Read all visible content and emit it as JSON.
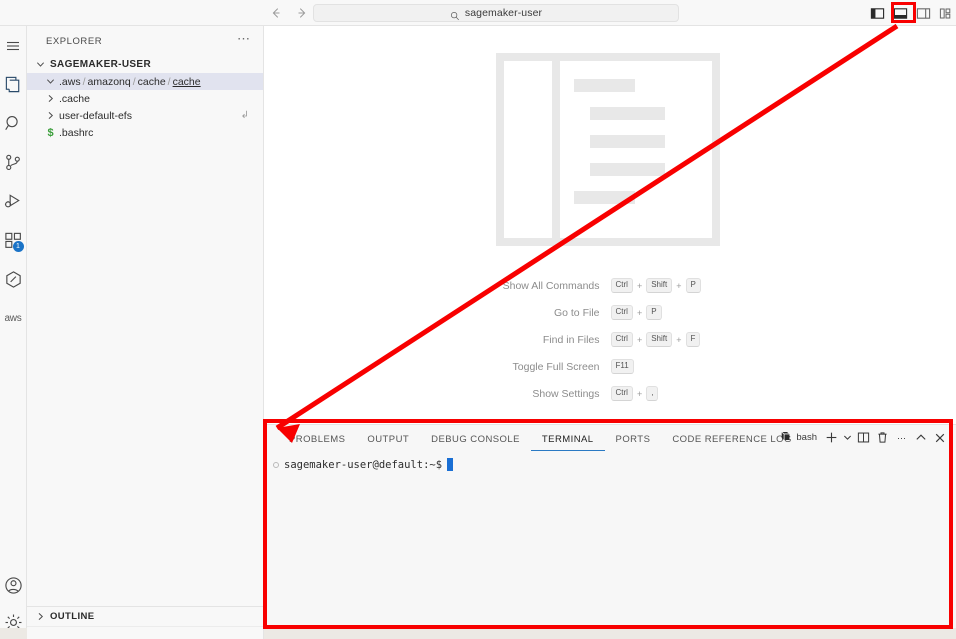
{
  "titlebar": {
    "back_icon": "arrow-left-icon",
    "forward_icon": "arrow-right-icon",
    "command_center": {
      "search_icon": "search-icon",
      "value": "sagemaker-user"
    },
    "layout_buttons": [
      {
        "name": "toggle-primary-sidebar",
        "icon": "panel-left-icon"
      },
      {
        "name": "toggle-panel",
        "icon": "panel-bottom-icon"
      },
      {
        "name": "toggle-secondary-sidebar",
        "icon": "panel-right-icon"
      },
      {
        "name": "customize-layout",
        "icon": "layout-grid-icon"
      }
    ]
  },
  "activitybar": {
    "items": [
      {
        "name": "menu",
        "icon": "hamburger-menu-icon",
        "badge": ""
      },
      {
        "name": "explorer",
        "icon": "files-icon",
        "badge": ""
      },
      {
        "name": "search",
        "icon": "search-icon",
        "badge": ""
      },
      {
        "name": "source-control",
        "icon": "source-control-icon",
        "badge": ""
      },
      {
        "name": "run-and-debug",
        "icon": "run-debug-icon",
        "badge": ""
      },
      {
        "name": "extensions",
        "icon": "extensions-icon",
        "badge": "1"
      },
      {
        "name": "jupyter",
        "icon": "hexagon-icon",
        "badge": ""
      },
      {
        "name": "aws-toolkit",
        "icon": "aws-icon",
        "badge": ""
      }
    ],
    "bottom_items": [
      {
        "name": "accounts",
        "icon": "account-icon"
      },
      {
        "name": "manage-settings",
        "icon": "gear-icon"
      }
    ]
  },
  "sidebar": {
    "title": "EXPLORER",
    "actions_icon": "ellipsis-icon",
    "root": {
      "label": "SAGEMAKER-USER",
      "chevron": "chevron-down-icon"
    },
    "tree": [
      {
        "label_segments": ".aws / amazonq / cache / cache",
        "segments": [
          ".aws",
          "amazonq",
          "cache",
          "cache"
        ],
        "chevron": "chevron-down-icon",
        "selected": true,
        "underline_last": true,
        "trailing": ""
      },
      {
        "label": ".cache",
        "chevron": "chevron-right-icon",
        "selected": false,
        "trailing": ""
      },
      {
        "label": "user-default-efs",
        "chevron": "chevron-right-icon",
        "selected": false,
        "trailing": "symlink-icon"
      },
      {
        "label": ".bashrc",
        "icon": "shell-file-icon",
        "selected": false,
        "trailing": ""
      }
    ],
    "outline": {
      "label": "OUTLINE",
      "chevron": "chevron-right-icon"
    }
  },
  "welcome": {
    "graphic": "editor-placeholder-graphic",
    "shortcuts": [
      {
        "label": "Show All Commands",
        "keys": [
          "Ctrl",
          "Shift",
          "P"
        ]
      },
      {
        "label": "Go to File",
        "keys": [
          "Ctrl",
          "P"
        ]
      },
      {
        "label": "Find in Files",
        "keys": [
          "Ctrl",
          "Shift",
          "F"
        ]
      },
      {
        "label": "Toggle Full Screen",
        "keys": [
          "F11"
        ]
      },
      {
        "label": "Show Settings",
        "keys": [
          "Ctrl",
          ","
        ]
      }
    ]
  },
  "panel": {
    "tabs": [
      {
        "label": "PROBLEMS",
        "active": false
      },
      {
        "label": "OUTPUT",
        "active": false
      },
      {
        "label": "DEBUG CONSOLE",
        "active": false
      },
      {
        "label": "TERMINAL",
        "active": true
      },
      {
        "label": "PORTS",
        "active": false
      },
      {
        "label": "CODE REFERENCE LOG",
        "active": false
      }
    ],
    "actions": {
      "terminal_icon": "terminal-bash-icon",
      "terminal_label": "bash",
      "new_terminal": "plus-icon",
      "new_terminal_dropdown": "chevron-down-icon",
      "split_terminal": "split-icon",
      "kill_terminal": "trash-icon",
      "more_actions": "ellipsis-icon",
      "maximize_panel": "chevron-up-icon",
      "close_panel": "close-icon"
    },
    "terminal": {
      "marker": "command-marker-icon",
      "prompt": "sagemaker-user@default:~$",
      "cursor": "block-cursor"
    }
  },
  "annotations": {
    "highlight_color": "#f80000",
    "arrow": {
      "from": "toggle-panel-button",
      "to": "terminal-panel"
    }
  }
}
